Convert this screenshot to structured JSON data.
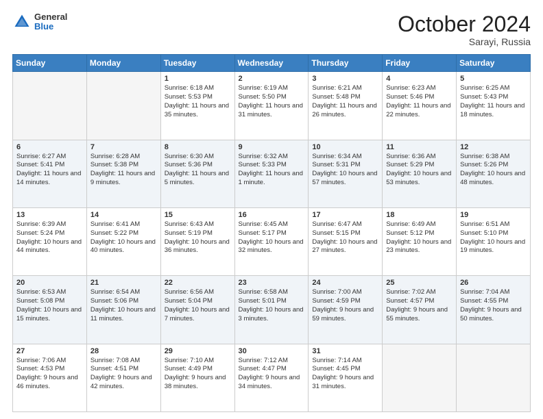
{
  "logo": {
    "general": "General",
    "blue": "Blue"
  },
  "title": "October 2024",
  "location": "Sarayi, Russia",
  "days_of_week": [
    "Sunday",
    "Monday",
    "Tuesday",
    "Wednesday",
    "Thursday",
    "Friday",
    "Saturday"
  ],
  "weeks": [
    [
      {
        "day": "",
        "info": ""
      },
      {
        "day": "",
        "info": ""
      },
      {
        "day": "1",
        "info": "Sunrise: 6:18 AM\nSunset: 5:53 PM\nDaylight: 11 hours and 35 minutes."
      },
      {
        "day": "2",
        "info": "Sunrise: 6:19 AM\nSunset: 5:50 PM\nDaylight: 11 hours and 31 minutes."
      },
      {
        "day": "3",
        "info": "Sunrise: 6:21 AM\nSunset: 5:48 PM\nDaylight: 11 hours and 26 minutes."
      },
      {
        "day": "4",
        "info": "Sunrise: 6:23 AM\nSunset: 5:46 PM\nDaylight: 11 hours and 22 minutes."
      },
      {
        "day": "5",
        "info": "Sunrise: 6:25 AM\nSunset: 5:43 PM\nDaylight: 11 hours and 18 minutes."
      }
    ],
    [
      {
        "day": "6",
        "info": "Sunrise: 6:27 AM\nSunset: 5:41 PM\nDaylight: 11 hours and 14 minutes."
      },
      {
        "day": "7",
        "info": "Sunrise: 6:28 AM\nSunset: 5:38 PM\nDaylight: 11 hours and 9 minutes."
      },
      {
        "day": "8",
        "info": "Sunrise: 6:30 AM\nSunset: 5:36 PM\nDaylight: 11 hours and 5 minutes."
      },
      {
        "day": "9",
        "info": "Sunrise: 6:32 AM\nSunset: 5:33 PM\nDaylight: 11 hours and 1 minute."
      },
      {
        "day": "10",
        "info": "Sunrise: 6:34 AM\nSunset: 5:31 PM\nDaylight: 10 hours and 57 minutes."
      },
      {
        "day": "11",
        "info": "Sunrise: 6:36 AM\nSunset: 5:29 PM\nDaylight: 10 hours and 53 minutes."
      },
      {
        "day": "12",
        "info": "Sunrise: 6:38 AM\nSunset: 5:26 PM\nDaylight: 10 hours and 48 minutes."
      }
    ],
    [
      {
        "day": "13",
        "info": "Sunrise: 6:39 AM\nSunset: 5:24 PM\nDaylight: 10 hours and 44 minutes."
      },
      {
        "day": "14",
        "info": "Sunrise: 6:41 AM\nSunset: 5:22 PM\nDaylight: 10 hours and 40 minutes."
      },
      {
        "day": "15",
        "info": "Sunrise: 6:43 AM\nSunset: 5:19 PM\nDaylight: 10 hours and 36 minutes."
      },
      {
        "day": "16",
        "info": "Sunrise: 6:45 AM\nSunset: 5:17 PM\nDaylight: 10 hours and 32 minutes."
      },
      {
        "day": "17",
        "info": "Sunrise: 6:47 AM\nSunset: 5:15 PM\nDaylight: 10 hours and 27 minutes."
      },
      {
        "day": "18",
        "info": "Sunrise: 6:49 AM\nSunset: 5:12 PM\nDaylight: 10 hours and 23 minutes."
      },
      {
        "day": "19",
        "info": "Sunrise: 6:51 AM\nSunset: 5:10 PM\nDaylight: 10 hours and 19 minutes."
      }
    ],
    [
      {
        "day": "20",
        "info": "Sunrise: 6:53 AM\nSunset: 5:08 PM\nDaylight: 10 hours and 15 minutes."
      },
      {
        "day": "21",
        "info": "Sunrise: 6:54 AM\nSunset: 5:06 PM\nDaylight: 10 hours and 11 minutes."
      },
      {
        "day": "22",
        "info": "Sunrise: 6:56 AM\nSunset: 5:04 PM\nDaylight: 10 hours and 7 minutes."
      },
      {
        "day": "23",
        "info": "Sunrise: 6:58 AM\nSunset: 5:01 PM\nDaylight: 10 hours and 3 minutes."
      },
      {
        "day": "24",
        "info": "Sunrise: 7:00 AM\nSunset: 4:59 PM\nDaylight: 9 hours and 59 minutes."
      },
      {
        "day": "25",
        "info": "Sunrise: 7:02 AM\nSunset: 4:57 PM\nDaylight: 9 hours and 55 minutes."
      },
      {
        "day": "26",
        "info": "Sunrise: 7:04 AM\nSunset: 4:55 PM\nDaylight: 9 hours and 50 minutes."
      }
    ],
    [
      {
        "day": "27",
        "info": "Sunrise: 7:06 AM\nSunset: 4:53 PM\nDaylight: 9 hours and 46 minutes."
      },
      {
        "day": "28",
        "info": "Sunrise: 7:08 AM\nSunset: 4:51 PM\nDaylight: 9 hours and 42 minutes."
      },
      {
        "day": "29",
        "info": "Sunrise: 7:10 AM\nSunset: 4:49 PM\nDaylight: 9 hours and 38 minutes."
      },
      {
        "day": "30",
        "info": "Sunrise: 7:12 AM\nSunset: 4:47 PM\nDaylight: 9 hours and 34 minutes."
      },
      {
        "day": "31",
        "info": "Sunrise: 7:14 AM\nSunset: 4:45 PM\nDaylight: 9 hours and 31 minutes."
      },
      {
        "day": "",
        "info": ""
      },
      {
        "day": "",
        "info": ""
      }
    ]
  ]
}
